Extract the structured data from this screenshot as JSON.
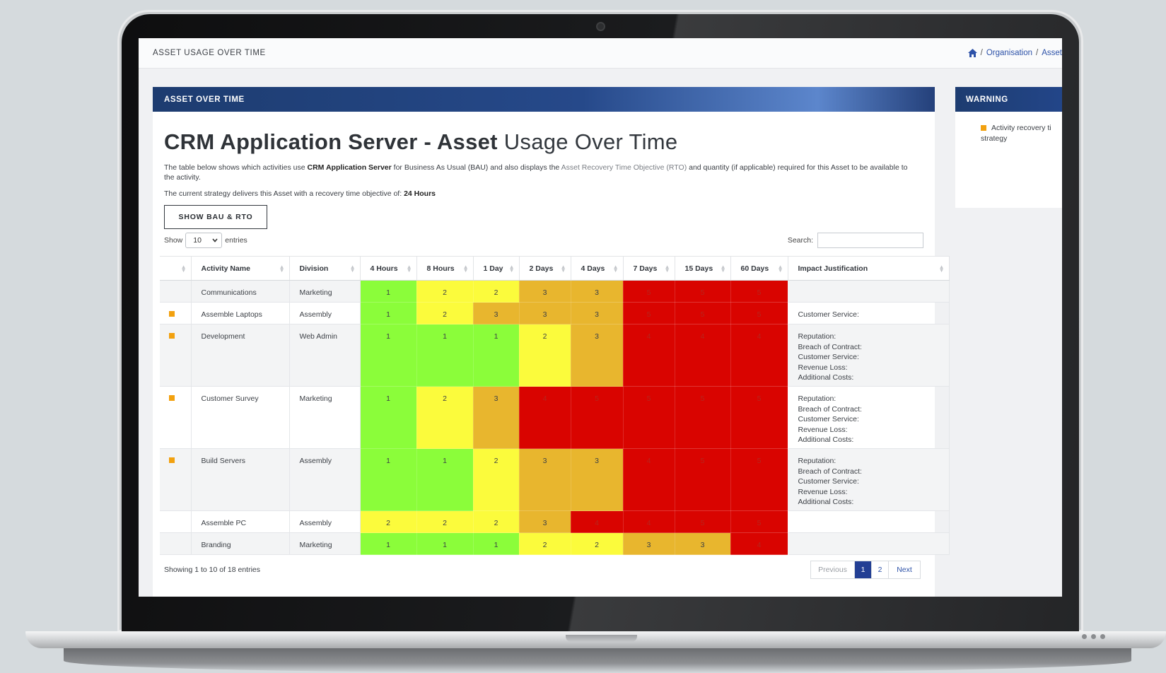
{
  "topbar": {
    "page_heading": "ASSET USAGE OVER TIME",
    "breadcrumb": [
      "Organisation",
      "Asset"
    ]
  },
  "main_panel": {
    "header": "ASSET OVER TIME",
    "title_strong": "CRM Application Server - Asset",
    "title_rest": "Usage Over Time",
    "desc_p1": "The table below shows which activities use ",
    "desc_bold": "CRM Application Server",
    "desc_p2": " for Business As Usual (BAU) and also displays the ",
    "desc_muted": "Asset Recovery Time Objective (RTO)",
    "desc_p3": " and quantity (if applicable) required for this Asset to be available to the activity.",
    "rto_prefix": "The current strategy delivers this Asset with a recovery time objective of: ",
    "rto_value": "24 Hours",
    "show_button": "SHOW BAU & RTO"
  },
  "controls": {
    "show_label": "Show",
    "entries_value": "10",
    "entries_label": "entries",
    "search_label": "Search:"
  },
  "table": {
    "headers": [
      "",
      "Activity Name",
      "Division",
      "4 Hours",
      "8 Hours",
      "1 Day",
      "2 Days",
      "4 Days",
      "7 Days",
      "15 Days",
      "60 Days",
      "Impact Justification"
    ],
    "rows": [
      {
        "flag": false,
        "name": "Communications",
        "division": "Marketing",
        "levels": [
          1,
          2,
          2,
          3,
          3,
          5,
          5,
          5
        ],
        "impact": []
      },
      {
        "flag": true,
        "name": "Assemble Laptops",
        "division": "Assembly",
        "levels": [
          1,
          2,
          3,
          3,
          3,
          5,
          5,
          5
        ],
        "impact": [
          "Customer Service:"
        ]
      },
      {
        "flag": true,
        "name": "Development",
        "division": "Web Admin",
        "levels": [
          1,
          1,
          1,
          2,
          3,
          4,
          4,
          4
        ],
        "impact": [
          "Reputation:",
          "Breach of Contract:",
          "Customer Service:",
          "Revenue Loss:",
          "Additional Costs:"
        ]
      },
      {
        "flag": true,
        "name": "Customer Survey",
        "division": "Marketing",
        "levels": [
          1,
          2,
          3,
          4,
          5,
          5,
          5,
          5
        ],
        "impact": [
          "Reputation:",
          "Breach of Contract:",
          "Customer Service:",
          "Revenue Loss:",
          "Additional Costs:"
        ]
      },
      {
        "flag": true,
        "name": "Build Servers",
        "division": "Assembly",
        "levels": [
          1,
          1,
          2,
          3,
          3,
          4,
          5,
          5
        ],
        "impact": [
          "Reputation:",
          "Breach of Contract:",
          "Customer Service:",
          "Revenue Loss:",
          "Additional Costs:"
        ]
      },
      {
        "flag": false,
        "name": "Assemble PC",
        "division": "Assembly",
        "levels": [
          2,
          2,
          2,
          3,
          4,
          4,
          5,
          5
        ],
        "impact": []
      },
      {
        "flag": false,
        "name": "Branding",
        "division": "Marketing",
        "levels": [
          1,
          1,
          1,
          2,
          2,
          3,
          3,
          4
        ],
        "impact": []
      }
    ]
  },
  "level_colors": {
    "1": "#8bfd3a",
    "2": "#fbfb3c",
    "3": "#e8b62e",
    "4": "#d90400",
    "5": "#d90400"
  },
  "footer": {
    "info": "Showing 1 to 10 of 18 entries",
    "prev": "Previous",
    "pages": [
      "1",
      "2"
    ],
    "next": "Next"
  },
  "side_panel": {
    "header": "WARNING",
    "text_line1": "Activity recovery ti",
    "text_line2": "strategy"
  }
}
